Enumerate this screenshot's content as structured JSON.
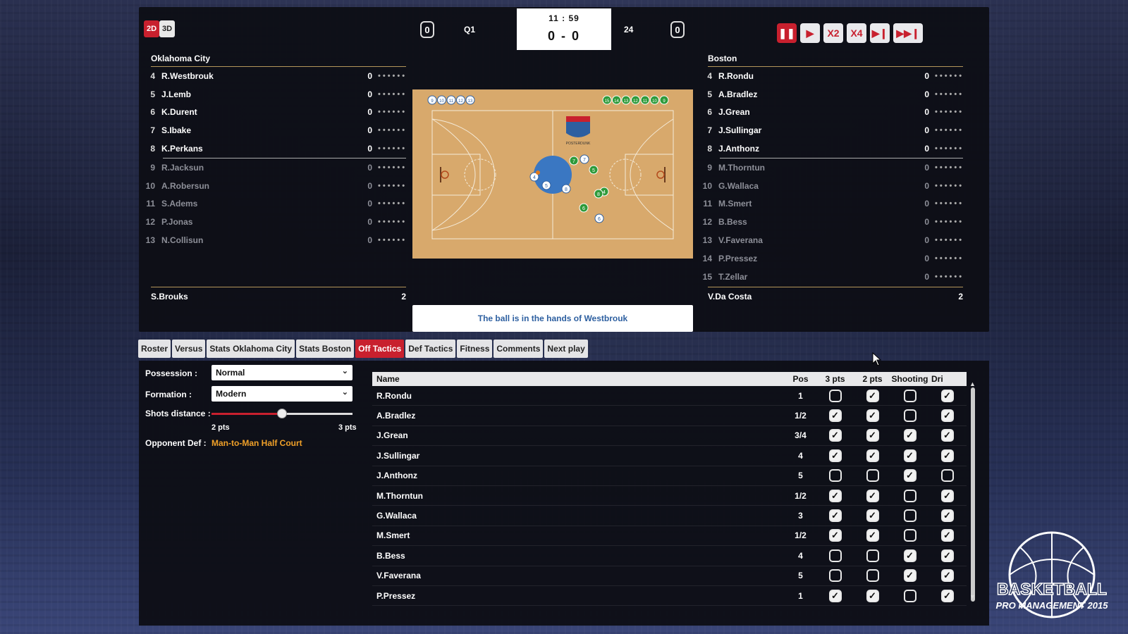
{
  "view_modes": {
    "two_d": "2D",
    "three_d": "3D"
  },
  "scoreboard": {
    "home_timeouts": "0",
    "away_timeouts": "0",
    "quarter": "Q1",
    "clock": "11 : 59",
    "score": "0 - 0",
    "shot_clock": "24"
  },
  "controls": [
    {
      "name": "pause-icon",
      "active": true
    },
    {
      "name": "play-icon",
      "active": false
    },
    {
      "name": "speed-x2",
      "label": "X2",
      "active": false
    },
    {
      "name": "speed-x4",
      "label": "X4",
      "active": false
    },
    {
      "name": "skip-next-icon",
      "active": false
    },
    {
      "name": "skip-end-icon",
      "active": false
    }
  ],
  "home": {
    "name": "Oklahoma City",
    "starters": [
      {
        "num": "4",
        "name": "R.Westbrouk",
        "pts": "0"
      },
      {
        "num": "5",
        "name": "J.Lemb",
        "pts": "0"
      },
      {
        "num": "6",
        "name": "K.Durent",
        "pts": "0"
      },
      {
        "num": "7",
        "name": "S.Ibake",
        "pts": "0"
      },
      {
        "num": "8",
        "name": "K.Perkans",
        "pts": "0"
      }
    ],
    "bench": [
      {
        "num": "9",
        "name": "R.Jacksun",
        "pts": "0"
      },
      {
        "num": "10",
        "name": "A.Robersun",
        "pts": "0"
      },
      {
        "num": "11",
        "name": "S.Adems",
        "pts": "0"
      },
      {
        "num": "12",
        "name": "P.Jonas",
        "pts": "0"
      },
      {
        "num": "13",
        "name": "N.Collisun",
        "pts": "0"
      }
    ],
    "coach": "S.Brouks",
    "coach_value": "2"
  },
  "away": {
    "name": "Boston",
    "starters": [
      {
        "num": "4",
        "name": "R.Rondu",
        "pts": "0"
      },
      {
        "num": "5",
        "name": "A.Bradlez",
        "pts": "0"
      },
      {
        "num": "6",
        "name": "J.Grean",
        "pts": "0"
      },
      {
        "num": "7",
        "name": "J.Sullingar",
        "pts": "0"
      },
      {
        "num": "8",
        "name": "J.Anthonz",
        "pts": "0"
      }
    ],
    "bench": [
      {
        "num": "9",
        "name": "M.Thorntun",
        "pts": "0"
      },
      {
        "num": "10",
        "name": "G.Wallaca",
        "pts": "0"
      },
      {
        "num": "11",
        "name": "M.Smert",
        "pts": "0"
      },
      {
        "num": "12",
        "name": "B.Bess",
        "pts": "0"
      },
      {
        "num": "13",
        "name": "V.Faverana",
        "pts": "0"
      },
      {
        "num": "14",
        "name": "P.Pressez",
        "pts": "0"
      },
      {
        "num": "15",
        "name": "T.Zellar",
        "pts": "0"
      }
    ],
    "coach": "V.Da Costa",
    "coach_value": "2"
  },
  "court": {
    "home_bench_numbers": [
      "9",
      "10",
      "11",
      "12",
      "13"
    ],
    "away_bench_numbers": [
      "15",
      "14",
      "13",
      "12",
      "11",
      "10",
      "9"
    ],
    "center_logo_text": "POSTERDUNK",
    "home_color": "#ffffff",
    "away_color": "#2e9a3a"
  },
  "play_message": "The ball is in the hands of Westbrouk",
  "tabs": [
    {
      "label": "Roster",
      "active": false
    },
    {
      "label": "Versus",
      "active": false
    },
    {
      "label": "Stats Oklahoma City",
      "active": false
    },
    {
      "label": "Stats Boston",
      "active": false
    },
    {
      "label": "Off Tactics",
      "active": true
    },
    {
      "label": "Def Tactics",
      "active": false
    },
    {
      "label": "Fitness",
      "active": false
    },
    {
      "label": "Comments",
      "active": false
    },
    {
      "label": "Next play",
      "active": false
    }
  ],
  "tactics": {
    "possession_label": "Possession :",
    "possession_value": "Normal",
    "formation_label": "Formation :",
    "formation_value": "Modern",
    "shots_distance_label": "Shots distance :",
    "shots_distance_fraction": 0.5,
    "slider_min_label": "2 pts",
    "slider_max_label": "3 pts",
    "opponent_def_label": "Opponent Def :",
    "opponent_def_value": "Man-to-Man Half Court"
  },
  "table": {
    "headers": [
      "Name",
      "Pos",
      "3 pts",
      "2 pts",
      "Shooting",
      "Dri"
    ],
    "rows": [
      {
        "name": "R.Rondu",
        "pos": "1",
        "checks": [
          false,
          true,
          false,
          true
        ]
      },
      {
        "name": "A.Bradlez",
        "pos": "1/2",
        "checks": [
          true,
          true,
          false,
          true
        ]
      },
      {
        "name": "J.Grean",
        "pos": "3/4",
        "checks": [
          true,
          true,
          true,
          true
        ]
      },
      {
        "name": "J.Sullingar",
        "pos": "4",
        "checks": [
          true,
          true,
          true,
          true
        ]
      },
      {
        "name": "J.Anthonz",
        "pos": "5",
        "checks": [
          false,
          false,
          true,
          false
        ]
      },
      {
        "name": "M.Thorntun",
        "pos": "1/2",
        "checks": [
          true,
          true,
          false,
          true
        ]
      },
      {
        "name": "G.Wallaca",
        "pos": "3",
        "checks": [
          true,
          true,
          false,
          true
        ]
      },
      {
        "name": "M.Smert",
        "pos": "1/2",
        "checks": [
          true,
          true,
          false,
          true
        ]
      },
      {
        "name": "B.Bess",
        "pos": "4",
        "checks": [
          false,
          false,
          true,
          true
        ]
      },
      {
        "name": "V.Faverana",
        "pos": "5",
        "checks": [
          false,
          false,
          true,
          true
        ]
      },
      {
        "name": "P.Pressez",
        "pos": "1",
        "checks": [
          true,
          true,
          false,
          true
        ]
      }
    ]
  },
  "logo": {
    "line1": "BASKETBALL",
    "line2": "PRO MANAGEMENT 2015"
  }
}
